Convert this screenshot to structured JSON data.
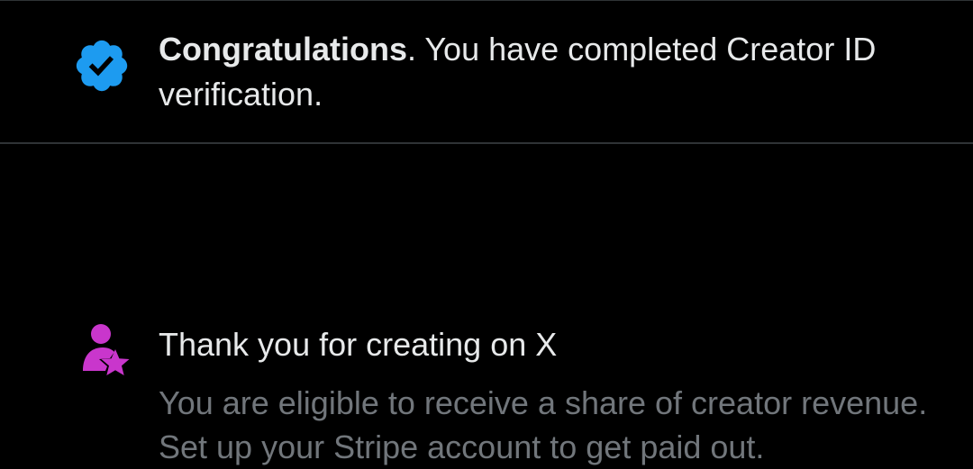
{
  "colors": {
    "background": "#000000",
    "divider": "#2f3336",
    "primary_text": "#e7e9ea",
    "secondary_text": "#71767b",
    "verified_blue": "#1d9bf0",
    "creator_purple": "#c936cc"
  },
  "notifications": [
    {
      "icon": "verified-badge-icon",
      "title_bold": "Congratulations",
      "title_rest": ".  You have completed Creator ID verification."
    },
    {
      "icon": "person-star-icon",
      "title": "Thank you for creating on X",
      "body": "You are eligible to receive a share of creator revenue. Set up your Stripe account to get paid out."
    }
  ]
}
